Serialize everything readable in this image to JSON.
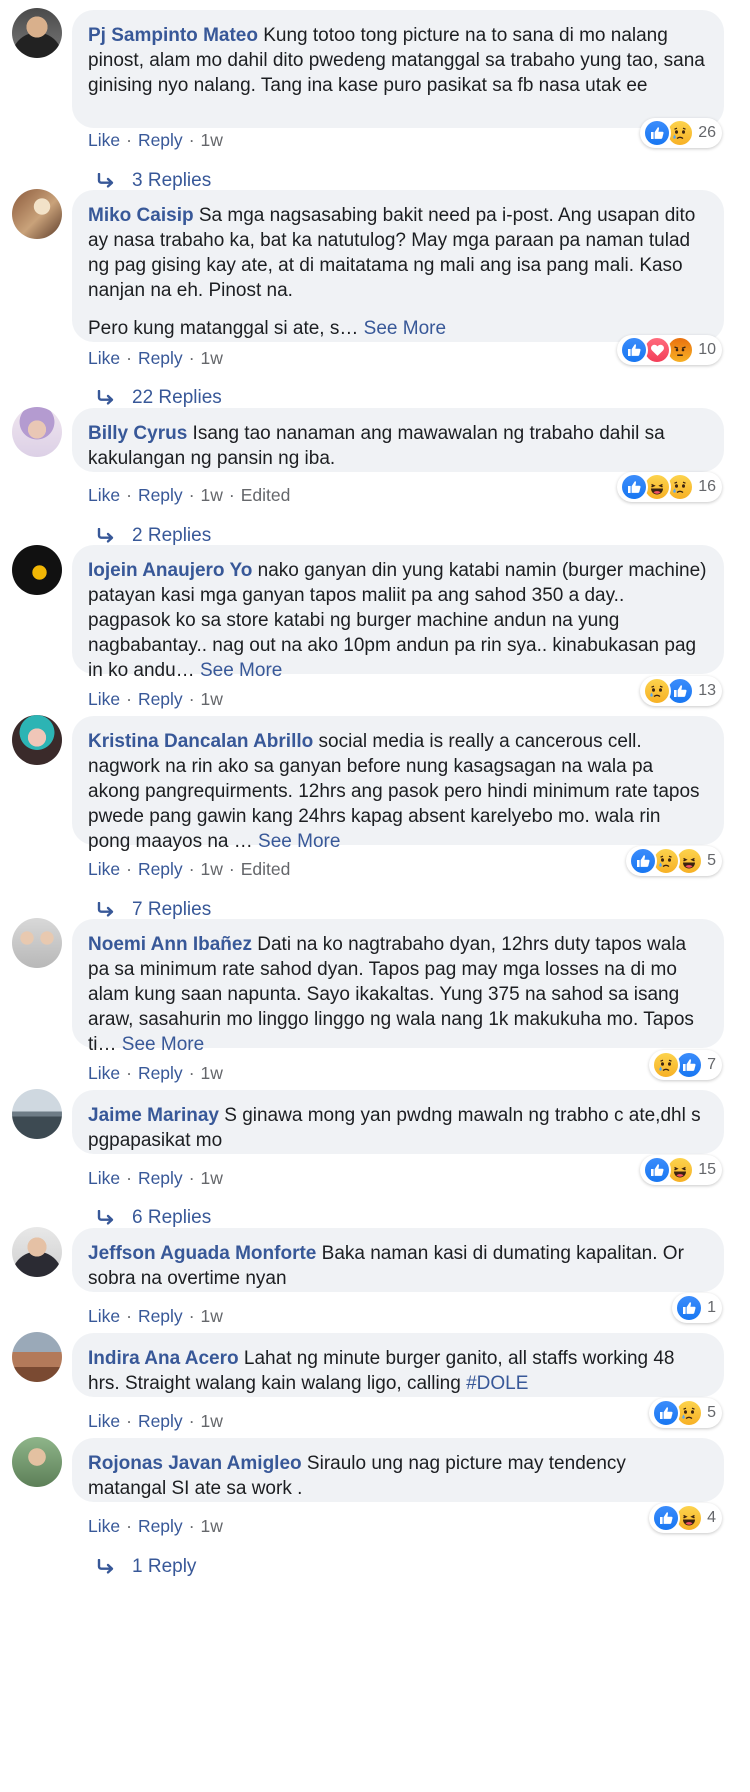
{
  "actions": {
    "like": "Like",
    "reply": "Reply",
    "separator": "·"
  },
  "reaction_colors": {
    "like": "#1877f2",
    "love": "#f33e58",
    "haha": "#f7b125",
    "sad": "#f7b125",
    "angry": "#e9710f"
  },
  "comments": [
    {
      "author": "Pj Sampinto Mateo",
      "text": "Kung totoo tong picture na to sana di mo nalang pinost, alam mo dahil dito pwedeng matanggal sa trabaho yung tao, sana ginising nyo nalang. Tang ina kase puro pasikat sa fb nasa utak ee",
      "time": "1w",
      "reactions": [
        "like",
        "sad"
      ],
      "reaction_count": "26",
      "replies": "3 Replies",
      "avatar": "avatar-photo"
    },
    {
      "author": "Miko Caisip",
      "text": "Sa mga nagsasabing bakit need pa i-post. Ang usapan dito ay nasa trabaho ka, bat ka natutulog? May mga paraan pa naman tulad ng pag gising kay ate, at di maitatama ng mali ang isa pang mali. Kaso nanjan na eh. Pinost na.",
      "text2": "Pero kung matanggal si ate, s…",
      "see_more": "See More",
      "time": "1w",
      "reactions": [
        "like",
        "love",
        "angry"
      ],
      "reaction_count": "10",
      "replies": "22 Replies",
      "avatar": "avatar-photo"
    },
    {
      "author": "Billy Cyrus",
      "text": "Isang tao nanaman ang mawawalan ng trabaho dahil sa kakulangan ng pansin ng iba.",
      "time": "1w",
      "edited": "Edited",
      "reactions": [
        "like",
        "haha",
        "sad"
      ],
      "reaction_count": "16",
      "replies": "2 Replies",
      "avatar": "avatar-photo"
    },
    {
      "author": "Iojein Anaujero Yo",
      "text": "nako ganyan din yung katabi namin (burger machine) patayan kasi mga ganyan tapos maliit pa ang sahod 350 a day.. pagpasok ko sa store katabi ng burger machine andun na yung nagbabantay.. nag out na ako 10pm andun pa rin sya.. kinabukasan pag in ko andu…",
      "see_more": "See More",
      "time": "1w",
      "reactions": [
        "sad",
        "like"
      ],
      "reaction_count": "13",
      "avatar": "avatar-photo"
    },
    {
      "author": "Kristina Dancalan Abrillo",
      "text": "social media is really a cancerous cell. nagwork na rin ako sa ganyan before nung kasagsagan na wala pa akong pangrequirments. 12hrs ang pasok pero hindi minimum rate tapos pwede pang gawin kang 24hrs kapag absent karelyebo mo. wala rin pong maayos na …",
      "see_more": "See More",
      "time": "1w",
      "edited": "Edited",
      "reactions": [
        "like",
        "sad",
        "haha"
      ],
      "reaction_count": "5",
      "replies": "7 Replies",
      "avatar": "avatar-photo"
    },
    {
      "author": "Noemi Ann Ibañez",
      "text": "Dati na ko nagtrabaho dyan, 12hrs duty tapos wala pa sa minimum rate sahod dyan. Tapos pag may mga losses na di mo alam kung saan napunta. Sayo ikakaltas. Yung 375 na sahod sa isang araw, sasahurin mo linggo linggo ng wala nang 1k makukuha mo. Tapos ti…",
      "see_more": "See More",
      "time": "1w",
      "reactions": [
        "sad",
        "like"
      ],
      "reaction_count": "7",
      "avatar": "avatar-photo"
    },
    {
      "author": "Jaime Marinay",
      "text": "S ginawa mong yan pwdng mawaln ng trabho c ate,dhl s pgpapasikat mo",
      "time": "1w",
      "reactions": [
        "like",
        "haha"
      ],
      "reaction_count": "15",
      "replies": "6 Replies",
      "avatar": "avatar-photo"
    },
    {
      "author": "Jeffson Aguada Monforte",
      "text": "Baka naman kasi di dumating kapalitan. Or sobra na overtime nyan",
      "time": "1w",
      "reactions": [
        "like"
      ],
      "reaction_count": "1",
      "avatar": "avatar-photo"
    },
    {
      "author": "Indira Ana Acero",
      "text": "Lahat ng minute burger ganito, all staffs working 48 hrs. Straight walang kain walang ligo, calling",
      "hashtag": "#DOLE",
      "time": "1w",
      "reactions": [
        "like",
        "sad"
      ],
      "reaction_count": "5",
      "avatar": "avatar-photo"
    },
    {
      "author": "Rojonas Javan Amigleo",
      "text": "Siraulo ung nag picture may tendency matangal SI ate sa work .",
      "time": "1w",
      "reactions": [
        "like",
        "haha"
      ],
      "reaction_count": "4",
      "replies": "1 Reply",
      "avatar": "avatar-photo"
    }
  ]
}
